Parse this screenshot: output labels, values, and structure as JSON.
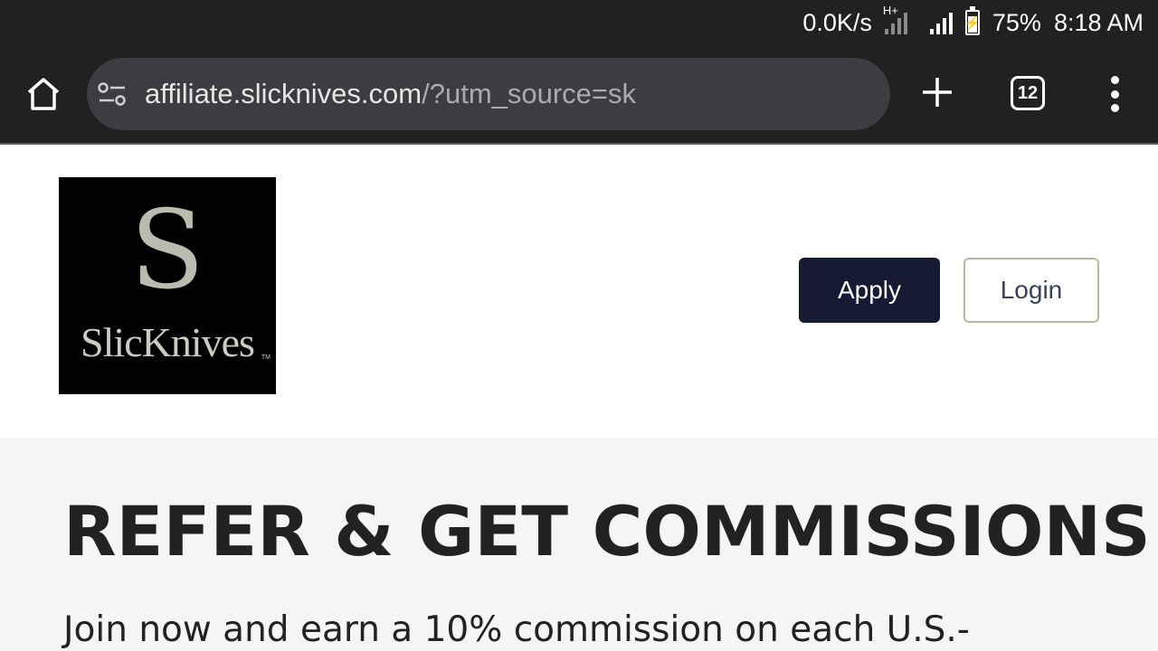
{
  "status_bar": {
    "net_speed": "0.0K/s",
    "network_type": "H+",
    "battery": "75%",
    "time": "8:18 AM",
    "icons": [
      "signal-icon",
      "battery-charging-icon"
    ]
  },
  "browser": {
    "url_host": "affiliate.slicknives.com",
    "url_rest": "/?utm_source=sk",
    "tab_count": "12",
    "icons": [
      "home-icon",
      "site-info-icon",
      "plus-icon",
      "tabs-icon",
      "more-vert-icon"
    ]
  },
  "header": {
    "logo": {
      "monogram": "S",
      "wordmark": "SlicKnives",
      "tm": "TM"
    },
    "apply_label": "Apply",
    "login_label": "Login",
    "colors": {
      "apply_bg": "#161a33",
      "login_border": "#b8b79f"
    }
  },
  "hero": {
    "title": "REFER & GET COMMISSIONS",
    "text": "Join now and earn a 10% commission on each U.S.-"
  }
}
